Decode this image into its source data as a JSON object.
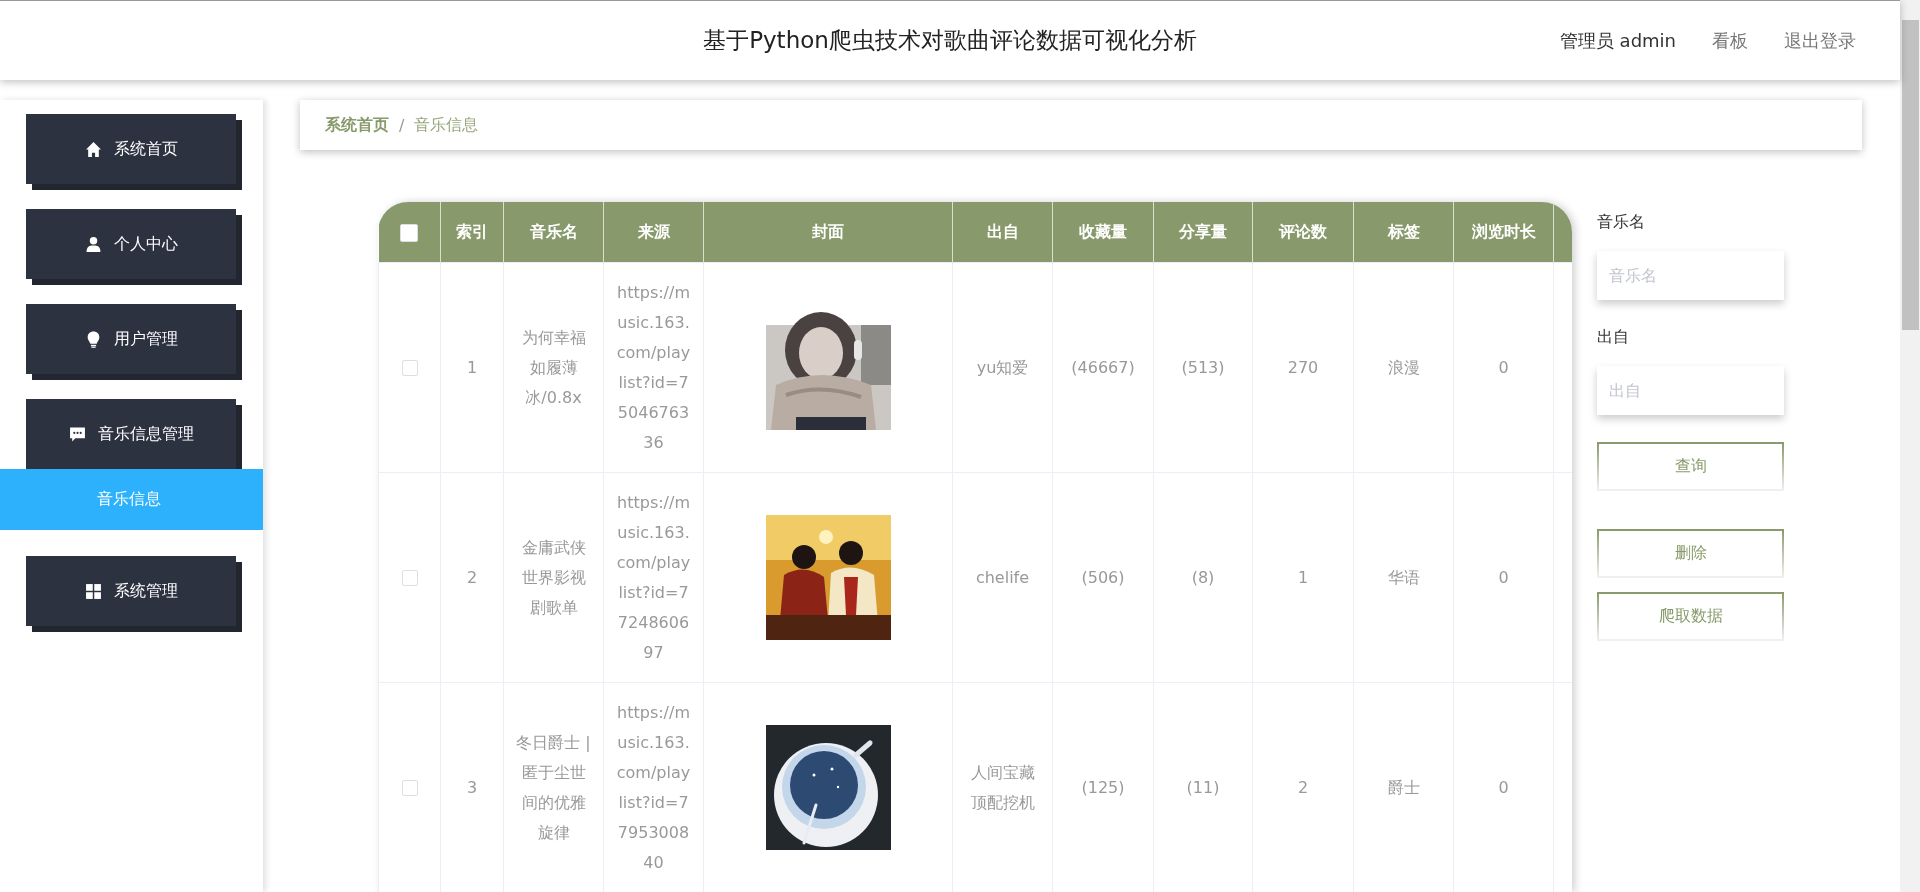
{
  "header": {
    "title": "基于Python爬虫技术对歌曲评论数据可视化分析",
    "nav": [
      {
        "label": "管理员 admin",
        "kind": "user"
      },
      {
        "label": "看板",
        "kind": "link"
      },
      {
        "label": "退出登录",
        "kind": "link"
      }
    ]
  },
  "sidebar": {
    "items": [
      {
        "label": "系统首页",
        "selected": false
      },
      {
        "label": "个人中心",
        "selected": false
      },
      {
        "label": "用户管理",
        "selected": false
      },
      {
        "label": "音乐信息管理",
        "selected": false,
        "expanded": true,
        "children": [
          {
            "label": "音乐信息",
            "selected": true
          }
        ]
      },
      {
        "label": "系统管理",
        "selected": false
      }
    ]
  },
  "breadcrumb": {
    "items": [
      "系统首页",
      "音乐信息"
    ],
    "separator": "/"
  },
  "table": {
    "select_all": {
      "checked": false
    },
    "columns": [
      {
        "label": "索引",
        "kind": "text"
      },
      {
        "label": "音乐名",
        "kind": "text"
      },
      {
        "label": "来源",
        "kind": "text"
      },
      {
        "label": "封面",
        "kind": "picture"
      },
      {
        "label": "出自",
        "kind": "text"
      },
      {
        "label": "收藏量",
        "kind": "text"
      },
      {
        "label": "分享量",
        "kind": "text"
      },
      {
        "label": "评论数",
        "kind": "text"
      },
      {
        "label": "标签",
        "kind": "text"
      },
      {
        "label": "浏览时长",
        "kind": "text"
      }
    ],
    "rows": [
      {
        "checked": false,
        "cells": [
          "1",
          "为何幸福如履薄冰/0.8x",
          "https://music.163.com/playlist?id=7504676336",
          {
            "kind": "picture"
          },
          "yu知爱",
          "(46667)",
          "(513)",
          "270",
          "浪漫",
          "0"
        ]
      },
      {
        "checked": false,
        "cells": [
          "2",
          "金庸武侠世界影视剧歌单",
          "https://music.163.com/playlist?id=7724860697",
          {
            "kind": "picture"
          },
          "chelife",
          "(506)",
          "(8)",
          "1",
          "华语",
          "0"
        ]
      },
      {
        "checked": false,
        "cells": [
          "3",
          "冬日爵士 | 匿于尘世间的优雅旋律",
          "https://music.163.com/playlist?id=7795300840",
          {
            "kind": "picture"
          },
          "人间宝藏顶配挖机",
          "(125)",
          "(11)",
          "2",
          "爵士",
          "0"
        ]
      }
    ]
  },
  "search": {
    "fields": [
      {
        "label": "音乐名",
        "placeholder": "音乐名"
      },
      {
        "label": "出自",
        "placeholder": "出自"
      }
    ],
    "search_button": "查询",
    "actions": [
      "删除",
      "爬取数据"
    ]
  }
}
